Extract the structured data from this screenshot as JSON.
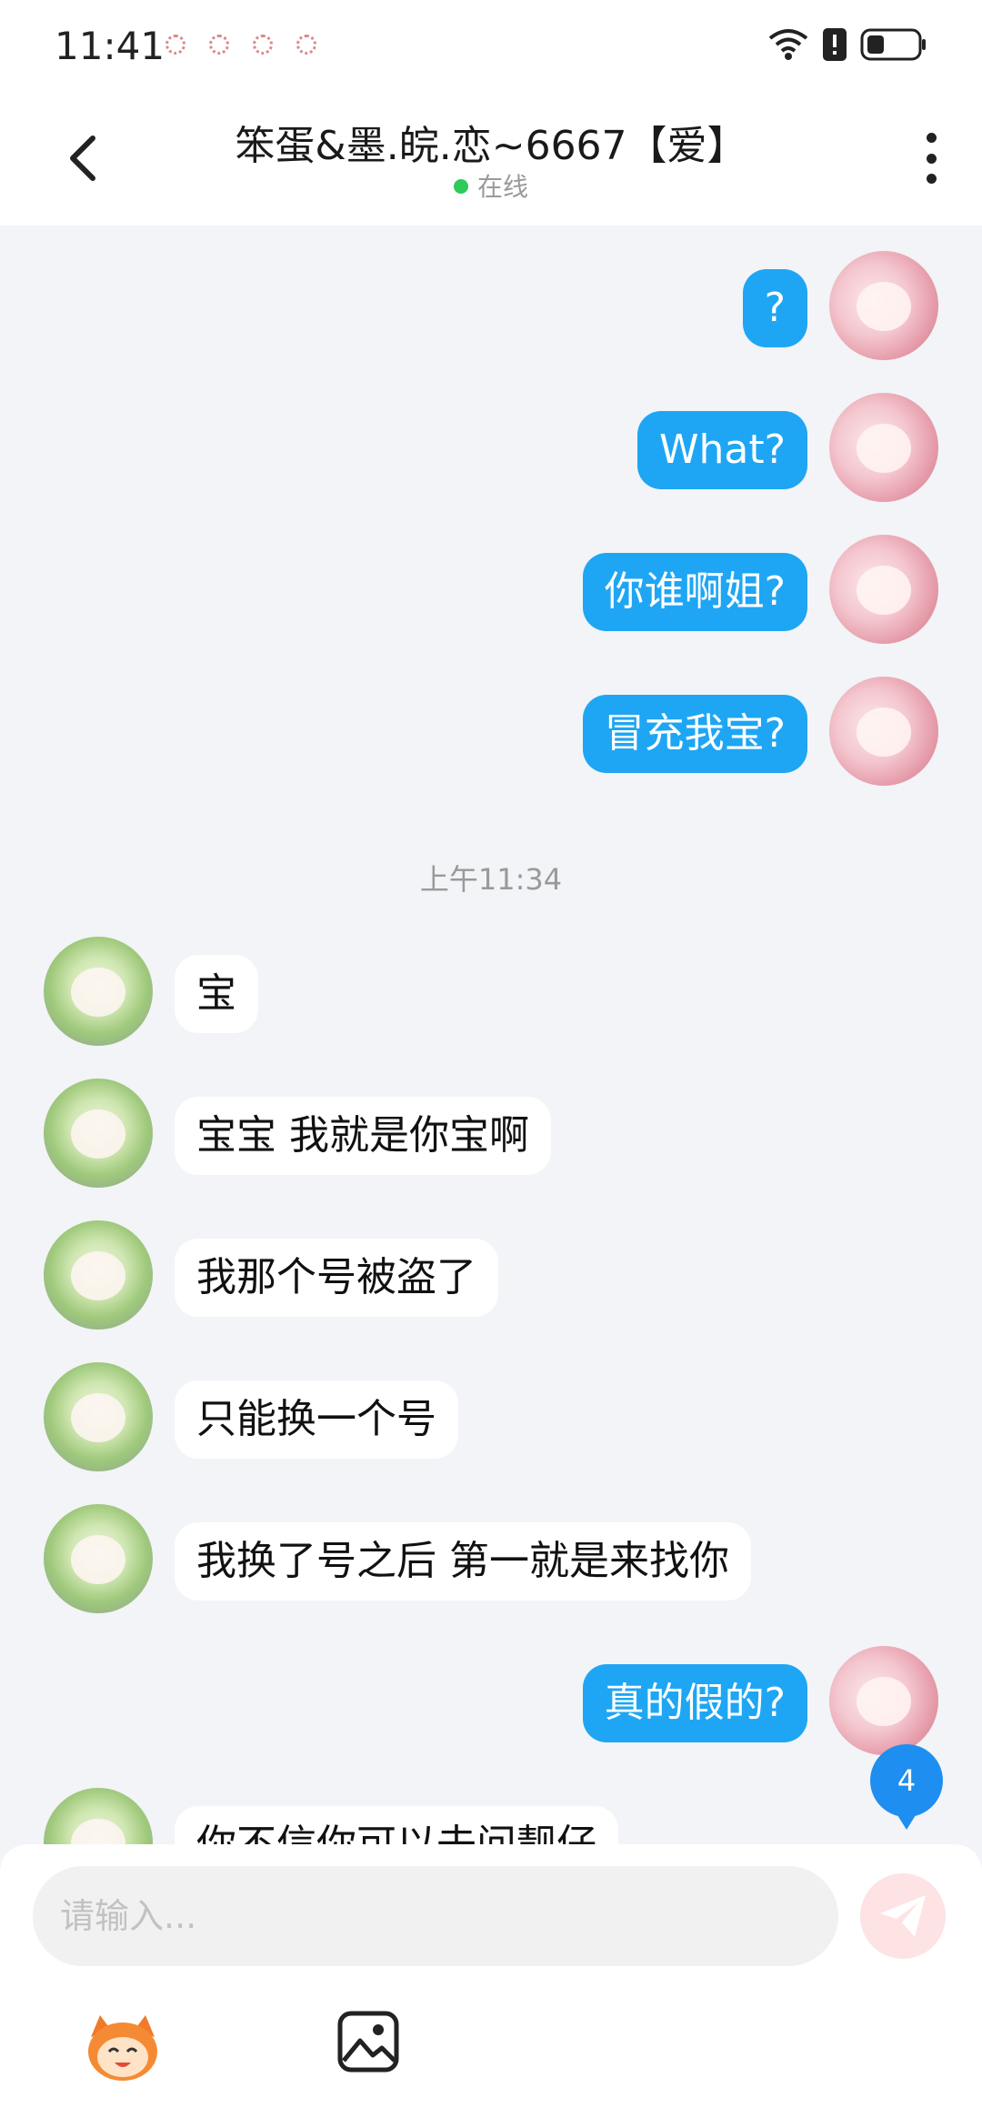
{
  "status_bar": {
    "time": "11:41"
  },
  "header": {
    "title": "笨蛋&墨.皖.恋~6667【爱】",
    "status": "在线"
  },
  "messages": [
    {
      "side": "me",
      "text": "?"
    },
    {
      "side": "me",
      "text": "What?"
    },
    {
      "side": "me",
      "text": "你谁啊姐?"
    },
    {
      "side": "me",
      "text": "冒充我宝?"
    },
    {
      "side": "other",
      "text": "宝"
    },
    {
      "side": "other",
      "text": "宝宝 我就是你宝啊"
    },
    {
      "side": "other",
      "text": "我那个号被盗了"
    },
    {
      "side": "other",
      "text": "只能换一个号"
    },
    {
      "side": "other",
      "text": "我换了号之后 第一就是来找你"
    },
    {
      "side": "me",
      "text": "真的假的?"
    },
    {
      "side": "other",
      "text": "你不信你可以去问靓仔"
    }
  ],
  "timestamp": "上午11:34",
  "unread_count": "4",
  "input": {
    "placeholder": "请输入..."
  },
  "colors": {
    "my_bubble": "#1ea6f4",
    "other_bubble": "#ffffff",
    "online_dot": "#2ec95a",
    "unread_badge": "#1e8ef0",
    "send_button": "#fde3e3"
  }
}
